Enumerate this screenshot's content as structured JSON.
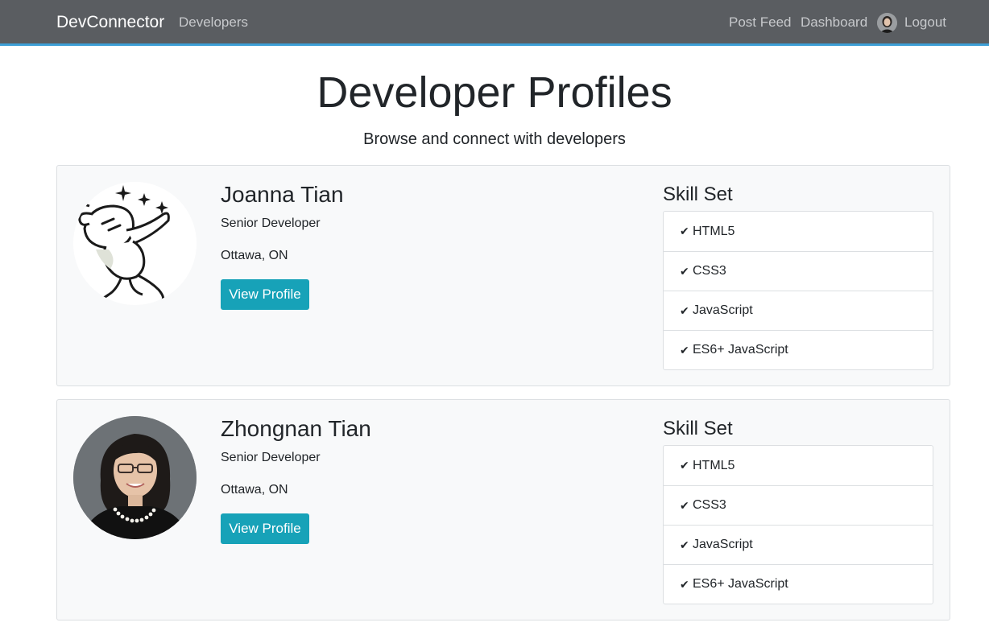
{
  "navbar": {
    "brand": "DevConnector",
    "developers": "Developers",
    "post_feed": "Post Feed",
    "dashboard": "Dashboard",
    "logout": "Logout"
  },
  "header": {
    "title": "Developer Profiles",
    "subtitle": "Browse and connect with developers"
  },
  "profiles": [
    {
      "name": "Joanna Tian",
      "status": "Senior Developer",
      "location": "Ottawa, ON",
      "button": "View Profile",
      "skill_title": "Skill Set",
      "skills": [
        "HTML5",
        "CSS3",
        "JavaScript",
        "ES6+ JavaScript"
      ]
    },
    {
      "name": "Zhongnan Tian",
      "status": "Senior Developer",
      "location": "Ottawa, ON",
      "button": "View Profile",
      "skill_title": "Skill Set",
      "skills": [
        "HTML5",
        "CSS3",
        "JavaScript",
        "ES6+ JavaScript"
      ]
    }
  ],
  "colors": {
    "navbar_bg": "#5a5d61",
    "navbar_accent": "#3d9fd6",
    "button": "#17a2b8",
    "card_bg": "#f8f9fa"
  },
  "icons": {
    "skill_bullet": "check-icon"
  }
}
